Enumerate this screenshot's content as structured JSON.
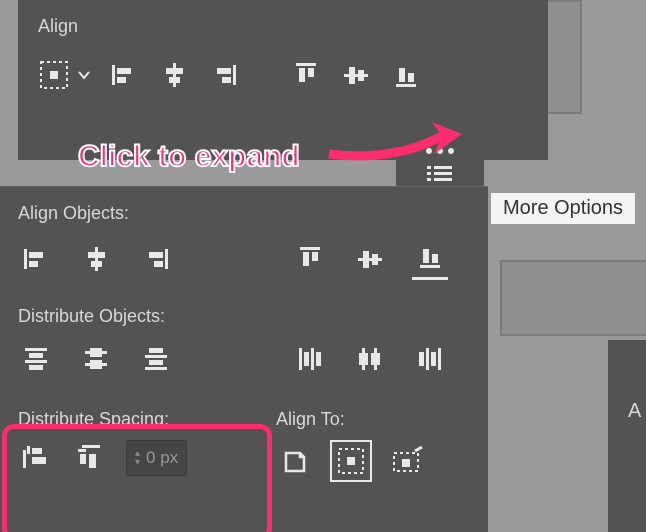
{
  "top_panel": {
    "title": "Align"
  },
  "annotation": {
    "text": "Click to expand"
  },
  "tooltip": {
    "text": "More Options"
  },
  "expanded": {
    "align_label": "Align Objects:",
    "distribute_label": "Distribute Objects:",
    "spacing_label": "Distribute Spacing:",
    "align_to_label": "Align To:",
    "spacing_value": "0 px"
  },
  "side": {
    "letter": "A"
  }
}
